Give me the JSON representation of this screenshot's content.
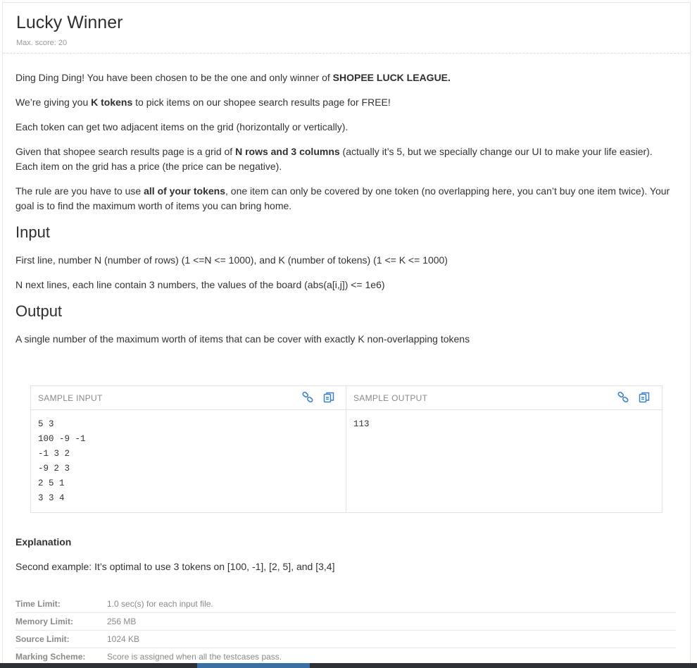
{
  "problem": {
    "title": "Lucky Winner",
    "max_score": "Max. score: 20"
  },
  "statement": {
    "p1_pre": "Ding Ding Ding! You have been chosen to be the one and only winner of ",
    "p1_bold": "SHOPEE LUCK LEAGUE.",
    "p2_pre": "We’re giving you ",
    "p2_bold": "K tokens",
    "p2_post": " to pick items on our shopee search results page for FREE!",
    "p3": "Each token can get two adjacent items on the grid (horizontally or vertically).",
    "p4_pre": "Given that shopee search results page is a grid of ",
    "p4_bold": "N rows and 3 columns",
    "p4_post": " (actually it’s 5, but we specially change our UI to make your life easier). Each item on the grid has a price (the price can be negative).",
    "p5_pre": "The rule are you have to use ",
    "p5_bold": "all of your tokens",
    "p5_post": ", one item can only be covered by one token (no overlapping here, you can’t buy one item twice). Your goal is to find the maximum worth of items you can bring home."
  },
  "input": {
    "heading": "Input",
    "line1": "First line, number N (number of rows) (1 <=N <= 1000), and K (number of tokens) (1 <= K <= 1000)",
    "line2": "N next lines, each line contain 3 numbers, the values of the board (abs(a[i,j]) <= 1e6)"
  },
  "output": {
    "heading": "Output",
    "line1": "A single number of the maximum worth of items that can be cover with exactly K non-overlapping tokens"
  },
  "samples": {
    "input_title": "SAMPLE INPUT",
    "output_title": "SAMPLE OUTPUT",
    "input_text": "5 3\n100 -9 -1\n-1 3 2\n-9 2 3\n2 5 1\n3 3 4",
    "output_text": "113",
    "link_icon": "link-icon",
    "copy_icon": "copy-icon",
    "icon_color": "#3b82c4"
  },
  "explanation": {
    "title": "Explanation",
    "text": "Second example: It’s optimal to use 3 tokens on [100, -1], [2, 5], and [3,4]"
  },
  "limits": [
    {
      "label": "Time Limit:",
      "value": "1.0 sec(s) for each input file."
    },
    {
      "label": "Memory Limit:",
      "value": "256 MB"
    },
    {
      "label": "Source Limit:",
      "value": "1024 KB"
    },
    {
      "label": "Marking Scheme:",
      "value": "Score is assigned when all the testcases pass."
    }
  ]
}
